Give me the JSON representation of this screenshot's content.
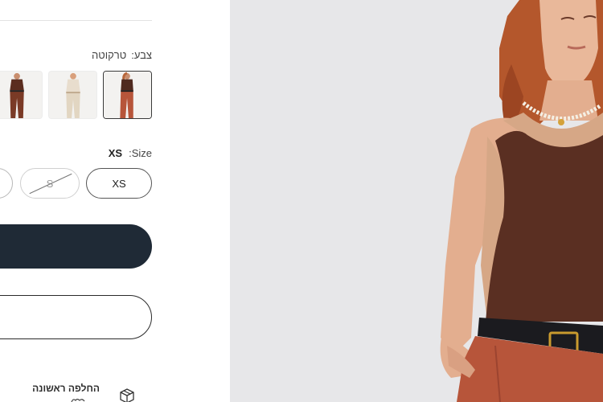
{
  "product": {
    "color_label": "צבע:",
    "color_value": "טרקוטה",
    "color_options": [
      {
        "name": "brown",
        "selected": false
      },
      {
        "name": "cream",
        "selected": false
      },
      {
        "name": "terracotta",
        "selected": true
      }
    ],
    "size_label": ":Size",
    "size_value": "XS",
    "sizes": [
      {
        "label": "",
        "available": true,
        "selected": false
      },
      {
        "label": "S",
        "available": false,
        "selected": false
      },
      {
        "label": "XS",
        "available": true,
        "selected": true
      }
    ],
    "primary_button_label": "",
    "secondary_button_label": ""
  },
  "feature": {
    "title": "החלפה ראשונה",
    "icon": "box-icon"
  },
  "colors": {
    "primary_button": "#1f2a36",
    "terracotta": "#b7553a",
    "chocolate": "#5a2f22",
    "photo_bg": "#e7e7e9"
  }
}
